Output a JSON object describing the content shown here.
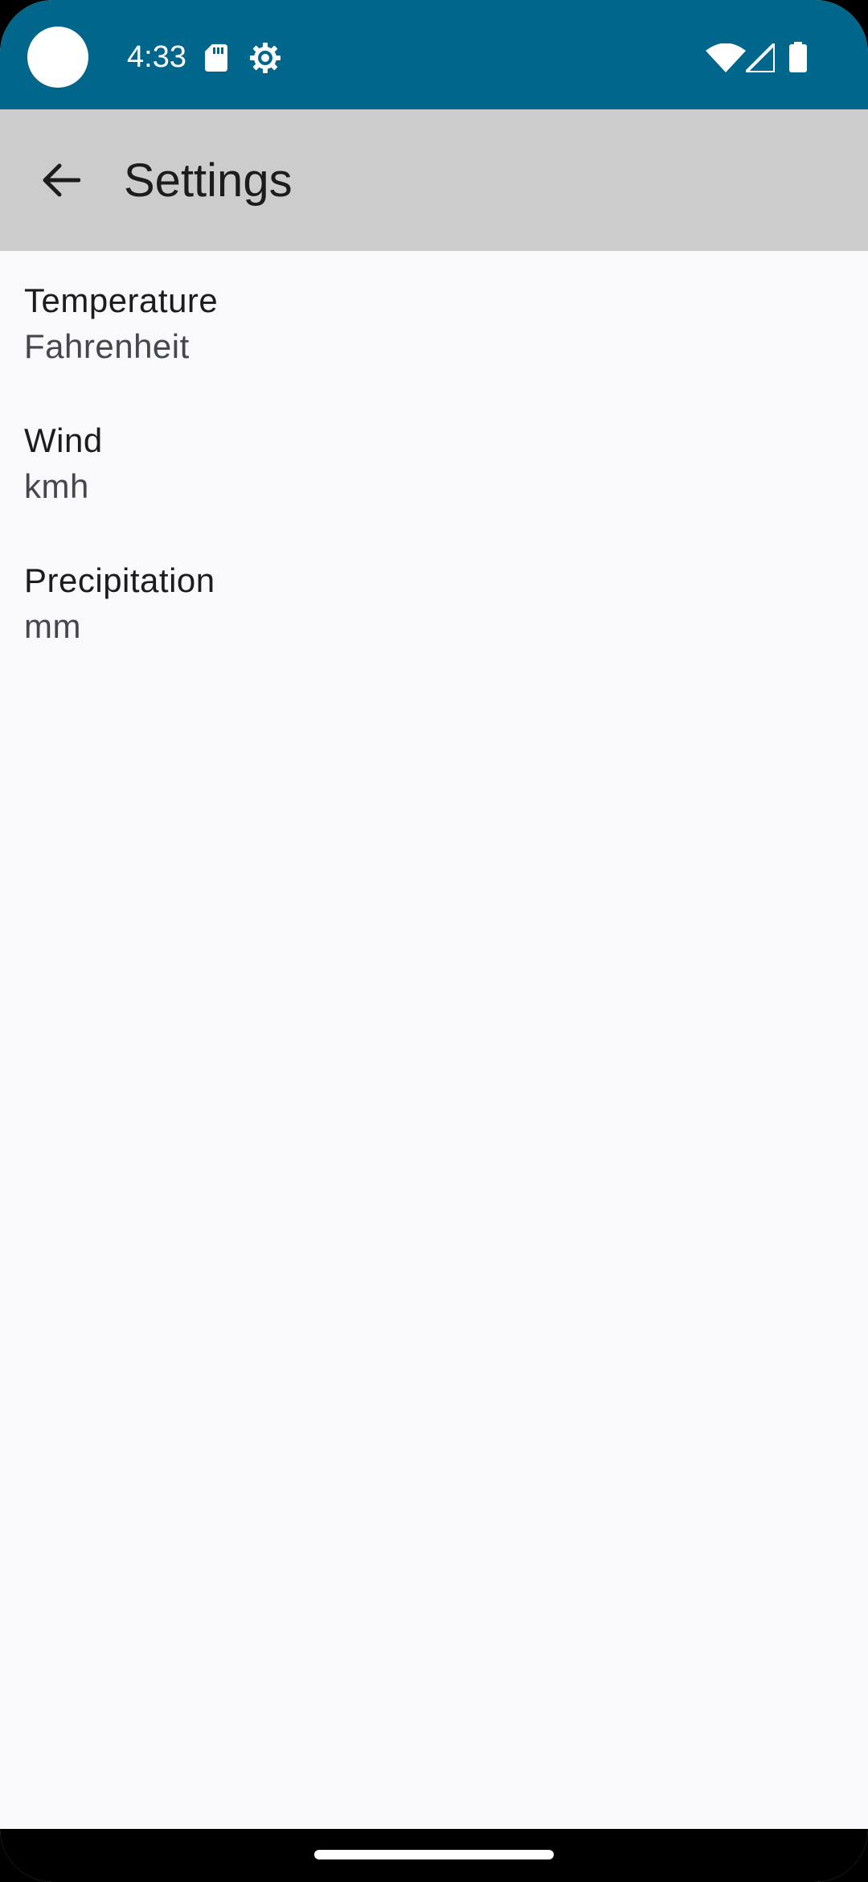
{
  "status_bar": {
    "time": "4:33",
    "icons": [
      "sd-card-icon",
      "settings-gear-icon",
      "wifi-icon",
      "cell-signal-icon",
      "battery-icon"
    ],
    "background_color": "#00668b"
  },
  "app_bar": {
    "title": "Settings",
    "back_icon": "arrow-back-icon",
    "background_color": "#cccccc"
  },
  "settings": {
    "items": [
      {
        "title": "Temperature",
        "value": "Fahrenheit"
      },
      {
        "title": "Wind",
        "value": "kmh"
      },
      {
        "title": "Precipitation",
        "value": "mm"
      }
    ]
  },
  "nav_bar": {
    "handle_icon": "home-gesture-handle"
  }
}
